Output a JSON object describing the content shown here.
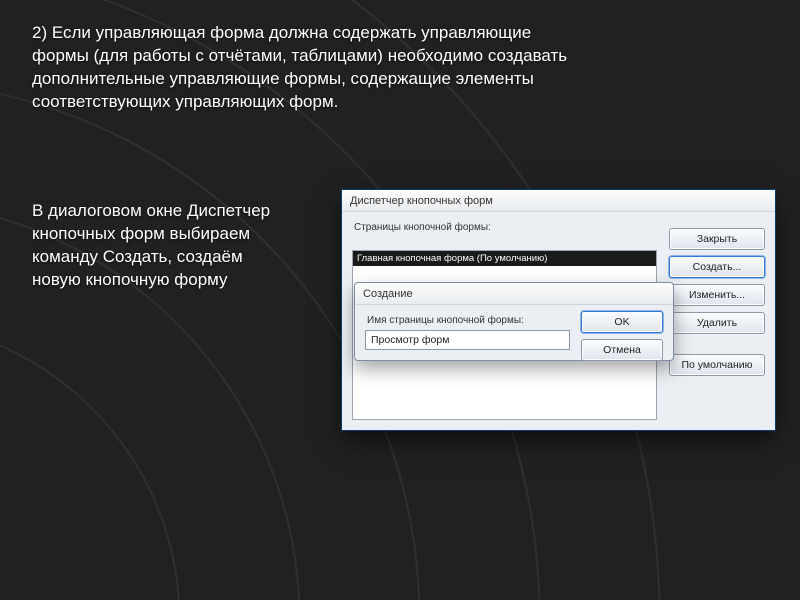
{
  "slide": {
    "paragraph1": "2) Если управляющая форма должна содержать управляющие формы (для работы с отчётами, таблицами) необходимо создавать дополнительные управляющие формы, содержащие элементы соответствующих управляющих форм.",
    "paragraph2": "В диалоговом окне Диспетчер кнопочных форм выбираем команду Создать, создаём новую кнопочную форму"
  },
  "dialog": {
    "title": "Диспетчер кнопочных форм",
    "pages_label": "Страницы кнопочной формы:",
    "selected_item": "Главная кнопочная форма (По умолчанию)",
    "buttons": {
      "close": "Закрыть",
      "create": "Создать...",
      "edit": "Изменить...",
      "delete": "Удалить",
      "default": "По умолчанию"
    }
  },
  "sub_dialog": {
    "title": "Создание",
    "name_label": "Имя страницы кнопочной формы:",
    "name_value": "Просмотр форм",
    "ok": "OK",
    "cancel": "Отмена"
  }
}
